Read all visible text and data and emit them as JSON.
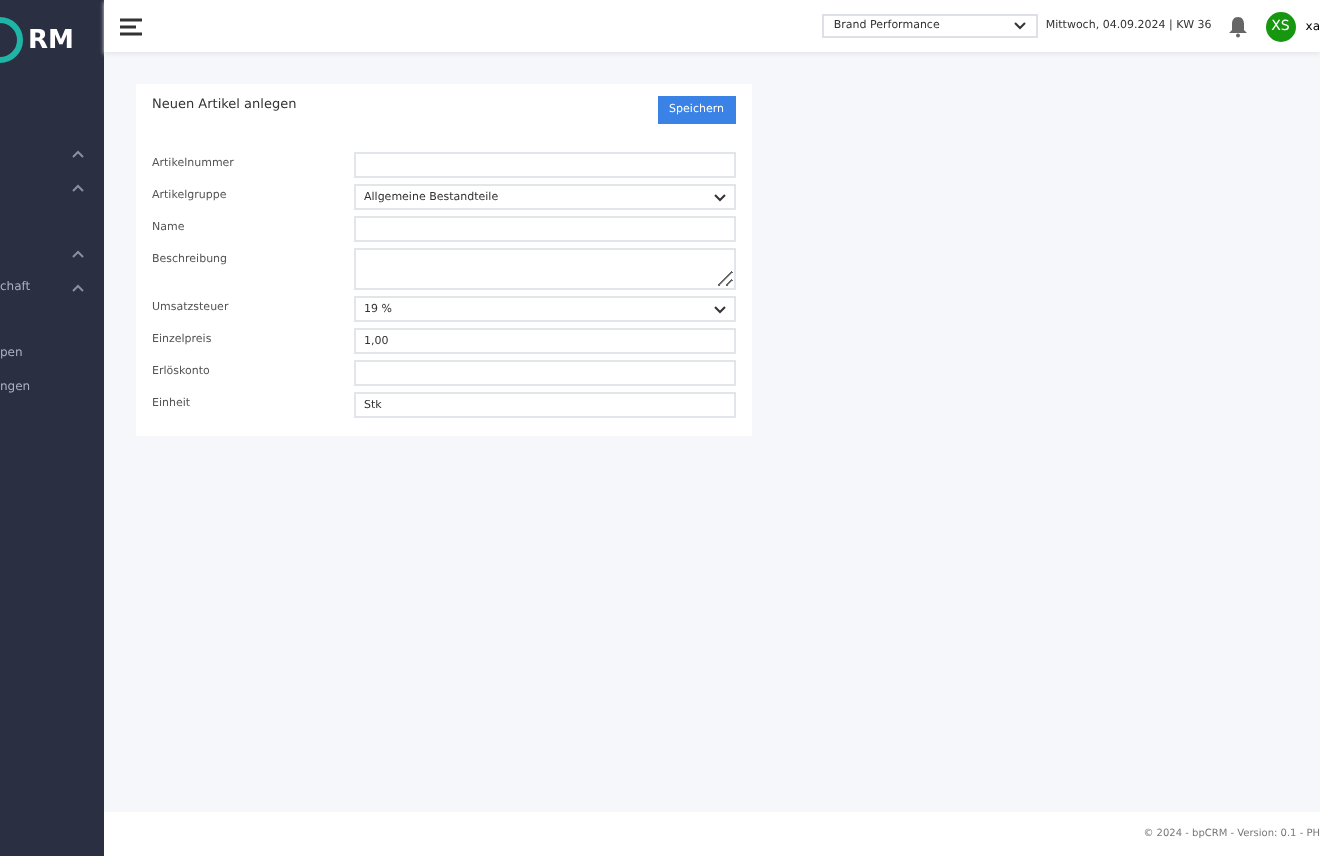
{
  "sidebar": {
    "logo_text": "RM",
    "items": [
      {
        "has_chevron": true
      },
      {
        "has_chevron": true
      },
      {
        "has_chevron": true
      },
      {
        "label": "chaft",
        "has_chevron": true
      },
      {
        "label": "pen",
        "has_chevron": false
      },
      {
        "label": "ngen",
        "has_chevron": false
      }
    ]
  },
  "topbar": {
    "dropdown": "Brand Performance",
    "date": "Mittwoch, 04.09.2024 | KW 36",
    "avatar": "XS",
    "user": "xa"
  },
  "card": {
    "title": "Neuen Artikel anlegen",
    "save_button": "Speichern",
    "fields": [
      {
        "label": "Artikelnummer",
        "kind": "text"
      },
      {
        "label": "Artikelgruppe",
        "kind": "select",
        "value": "Allgemeine Bestandteile"
      },
      {
        "label": "Name",
        "kind": "text"
      },
      {
        "label": "Beschreibung",
        "kind": "textarea"
      },
      {
        "label": "Umsatzsteuer",
        "kind": "select",
        "value": "19 %"
      },
      {
        "label": "Einzelpreis",
        "kind": "text",
        "value": "1,00"
      },
      {
        "label": "Erlöskonto",
        "kind": "text"
      },
      {
        "label": "Einheit",
        "kind": "text",
        "value": "Stk"
      }
    ]
  },
  "footer": "© 2024 - bpCRM - Version: 0.1 - PH"
}
